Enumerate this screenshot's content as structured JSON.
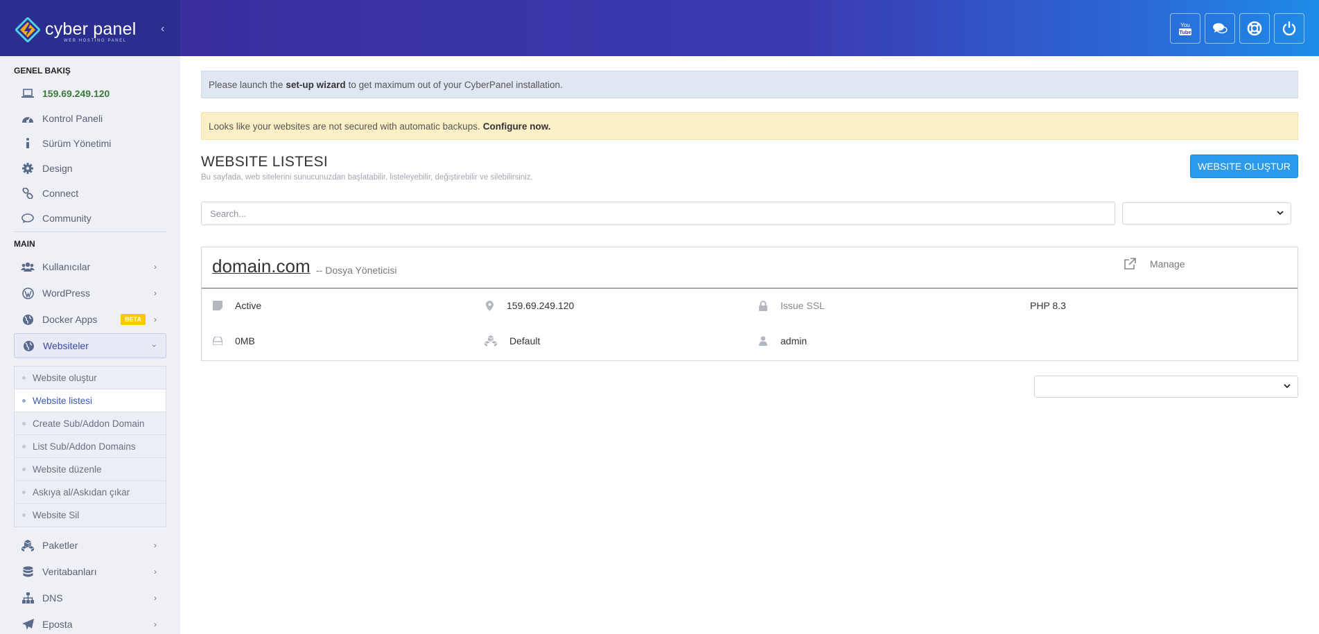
{
  "brand": {
    "name": "cyber panel",
    "tagline": "WEB HOSTING PANEL"
  },
  "sidebar": {
    "overview_title": "GENEL BAKIŞ",
    "ip": "159.69.249.120",
    "overview_items": [
      {
        "label": "Kontrol Paneli",
        "icon": "dashboard-icon"
      },
      {
        "label": "Sürüm Yönetimi",
        "icon": "info-icon"
      },
      {
        "label": "Design",
        "icon": "gear-icon"
      },
      {
        "label": "Connect",
        "icon": "link-icon"
      },
      {
        "label": "Community",
        "icon": "chat-icon"
      }
    ],
    "main_title": "MAIN",
    "main_items": [
      {
        "label": "Kullanıcılar",
        "icon": "users-icon"
      },
      {
        "label": "WordPress",
        "icon": "wordpress-icon"
      },
      {
        "label": "Docker Apps",
        "icon": "globe-icon",
        "badge": "BETA"
      },
      {
        "label": "Websiteler",
        "icon": "globe-icon"
      }
    ],
    "websites_submenu": [
      "Website oluştur",
      "Website listesi",
      "Create Sub/Addon Domain",
      "List Sub/Addon Domains",
      "Website düzenle",
      "Askıya al/Askıdan çıkar",
      "Website Sil"
    ],
    "more_items": [
      {
        "label": "Paketler",
        "icon": "packages-icon"
      },
      {
        "label": "Veritabanları",
        "icon": "database-icon"
      },
      {
        "label": "DNS",
        "icon": "sitemap-icon"
      },
      {
        "label": "Eposta",
        "icon": "paper-plane-icon"
      }
    ]
  },
  "header": {
    "buttons": [
      "youtube-icon",
      "comments-icon",
      "support-icon",
      "power-icon"
    ]
  },
  "alerts": {
    "setup_pre": "Please launch the",
    "setup_link": "set-up wizard",
    "setup_post": "to get maximum out of your CyberPanel installation.",
    "backup_text": "Looks like your websites are not secured with automatic backups.",
    "backup_link": "Configure now."
  },
  "page": {
    "title": "WEBSITE LISTESI",
    "subtitle": "Bu sayfada, web sitelerini sunucunuzdan başlatabilir, listeleyebilir, değiştirebilir ve silebilirsiniz.",
    "create_button": "WEBSITE OLUŞTUR",
    "search_placeholder": "Search..."
  },
  "website": {
    "domain": "domain.com",
    "file_manager": "-- Dosya Yöneticisi",
    "manage": "Manage",
    "status": "Active",
    "ip": "159.69.249.120",
    "ssl": "Issue SSL",
    "php": "PHP 8.3",
    "disk": "0MB",
    "package": "Default",
    "owner": "admin"
  },
  "colors": {
    "header_start": "#3a2ea0",
    "header_end": "#1e8ce6",
    "primary_button": "#2a9aec",
    "info_alert": "#dfe7f2",
    "warning_alert": "#fdf0c7",
    "beta_badge": "#f8c800"
  }
}
